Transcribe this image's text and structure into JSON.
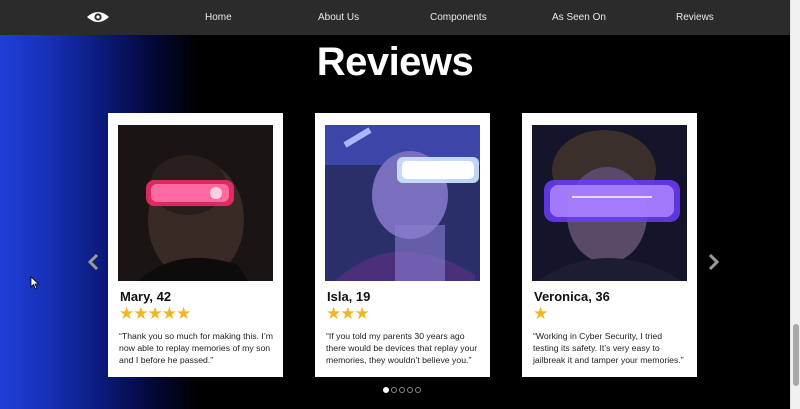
{
  "nav": {
    "logo_icon": "eye-icon",
    "links": [
      "Home",
      "About Us",
      "Components",
      "As Seen On",
      "Reviews"
    ]
  },
  "section": {
    "title": "Reviews"
  },
  "reviews": [
    {
      "name": "Mary, 42",
      "stars": "★★★★★",
      "rating": 5,
      "quote": "“Thank you so much for making this. I’m now able to replay memories of my son and I before he passed.”"
    },
    {
      "name": "Isla, 19",
      "stars": "★★★",
      "rating": 3,
      "quote": "“If you told my parents 30 years ago there would be devices that replay your memories, they wouldn’t believe you.”"
    },
    {
      "name": "Veronica, 36",
      "stars": "★",
      "rating": 1,
      "quote": "“Working in Cyber Security, I tried testing its safety. It’s very easy to jailbreak it and tamper your memories.”"
    }
  ],
  "carousel": {
    "prev_icon": "chevron-left-icon",
    "next_icon": "chevron-right-icon",
    "page_count": 5,
    "active_page": 1
  },
  "colors": {
    "star": "#f2b524",
    "navbar": "#2b2b2b",
    "gradient_blue": "#1f3fd8"
  }
}
